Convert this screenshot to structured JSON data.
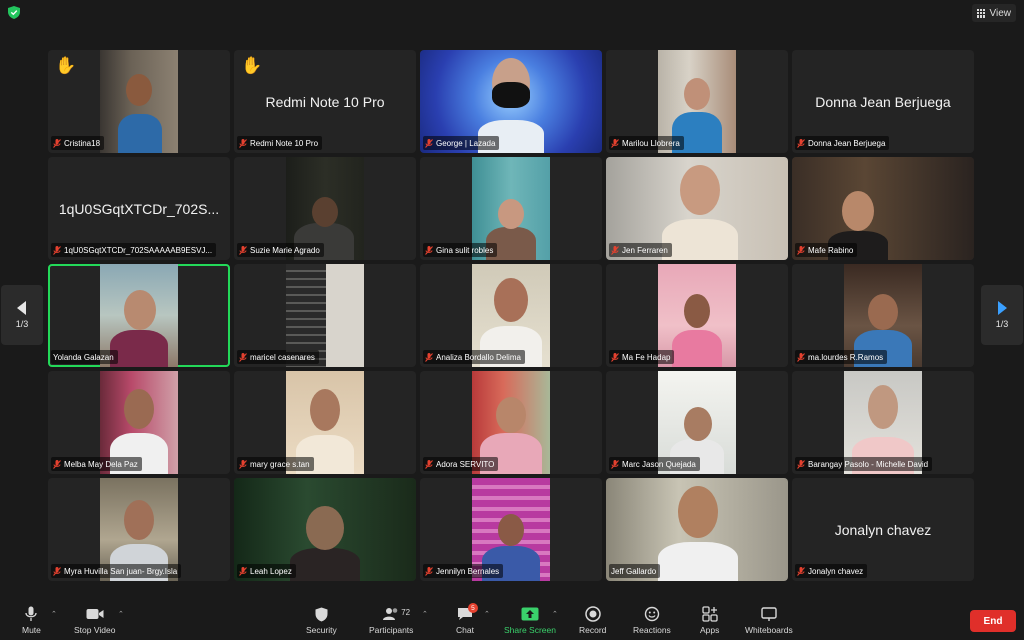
{
  "app": {
    "view_label": "View"
  },
  "pagination": {
    "left": "1/3",
    "right": "1/3"
  },
  "tiles": [
    {
      "label": "Cristina18"
    },
    {
      "label": "Redmi Note 10 Pro",
      "display_name": "Redmi Note 10 Pro"
    },
    {
      "label": "George | Lazada"
    },
    {
      "label": "Marilou Llobrera"
    },
    {
      "label": "Donna Jean Berjuega",
      "display_name": "Donna Jean Berjuega"
    },
    {
      "label": "1qU0SGqtXTCDr_702SAAAAAB9ESVJ...",
      "display_name": "1qU0SGqtXTCDr_702S..."
    },
    {
      "label": "Suzie Marie Agrado"
    },
    {
      "label": "Gina sulit robles"
    },
    {
      "label": "Jen Ferraren"
    },
    {
      "label": "Mafe  Rabino"
    },
    {
      "label": "Yolanda Galazan"
    },
    {
      "label": "maricel casenares"
    },
    {
      "label": "Analiza Bordallo Delima"
    },
    {
      "label": "Ma Fe Hadap"
    },
    {
      "label": "ma.lourdes R.Ramos"
    },
    {
      "label": "Melba May Dela Paz"
    },
    {
      "label": "mary grace s.tan"
    },
    {
      "label": "Adora SERVITO"
    },
    {
      "label": "Marc Jason Quejada"
    },
    {
      "label": "Barangay Pasolo - Michelle David"
    },
    {
      "label": "Myra Huvilla San juan- Brgy.Isla"
    },
    {
      "label": "Leah Lopez"
    },
    {
      "label": "Jennilyn Bernales"
    },
    {
      "label": "Jeff Gallardo"
    },
    {
      "label": "Jonalyn chavez",
      "display_name": "Jonalyn chavez"
    }
  ],
  "toolbar": {
    "mute": "Mute",
    "stop_video": "Stop Video",
    "security": "Security",
    "participants": "Participants",
    "participant_count": "72",
    "chat": "Chat",
    "chat_badge": "5",
    "share_screen": "Share Screen",
    "record": "Record",
    "reactions": "Reactions",
    "apps": "Apps",
    "whiteboards": "Whiteboards",
    "end": "End"
  },
  "colors": {
    "active_speaker": "#23d959",
    "share_green": "#3ad16b",
    "end_red": "#e02f2a",
    "muted_red": "#e5412f"
  }
}
